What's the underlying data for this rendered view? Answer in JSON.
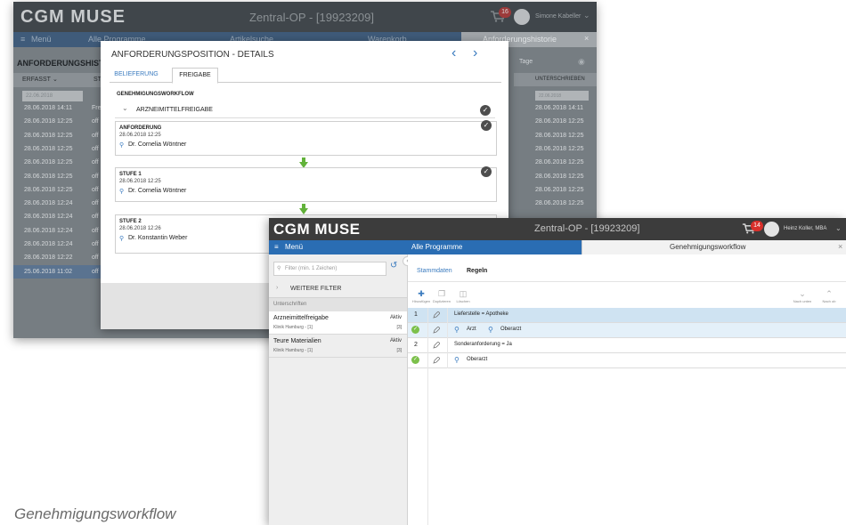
{
  "back_window": {
    "logo": "CGM MUSE",
    "title": "Zentral-OP - [19923209]",
    "badge": "16",
    "user": "Simone Kabeller",
    "nav": {
      "menu": "Menü",
      "programs": "Alle Programme",
      "articles": "Artikelsuche",
      "cart": "Warenkorb",
      "history_tab": "Anforderungshistorie"
    },
    "list_header": "ANFORDERUNGSHISTO",
    "col_erfasst": "ERFASST",
    "col_st": "ST",
    "date_filter": "22.06.2018",
    "rows": [
      {
        "date": "28.06.2018 14:11",
        "status": "Fre"
      },
      {
        "date": "28.06.2018 12:25",
        "status": "off"
      },
      {
        "date": "28.06.2018 12:25",
        "status": "off"
      },
      {
        "date": "28.06.2018 12:25",
        "status": "off"
      },
      {
        "date": "28.06.2018 12:25",
        "status": "off"
      },
      {
        "date": "28.06.2018 12:25",
        "status": "off"
      },
      {
        "date": "28.06.2018 12:25",
        "status": "off"
      },
      {
        "date": "28.06.2018 12:24",
        "status": "off"
      },
      {
        "date": "28.06.2018 12:24",
        "status": "off"
      },
      {
        "date": "28.06.2018 12:24",
        "status": "off"
      },
      {
        "date": "28.06.2018 12:24",
        "status": "off"
      },
      {
        "date": "28.06.2018 12:22",
        "status": "off"
      },
      {
        "date": "25.06.2018 11:02",
        "status": "off"
      }
    ],
    "right_panel": {
      "days": "Tage",
      "col": "UNTERSCHRIEBEN",
      "date_filter": "22.06.2018",
      "dates": [
        "28.06.2018 14:11",
        "28.06.2018 12:25",
        "28.06.2018 12:25",
        "28.06.2018 12:25",
        "28.06.2018 12:25",
        "28.06.2018 12:25",
        "28.06.2018 12:25",
        "28.06.2018 12:25"
      ]
    }
  },
  "modal": {
    "title": "ANFORDERUNGSPOSITION - DETAILS",
    "tab_belieferung": "BELIEFERUNG",
    "tab_freigabe": "FREIGABE",
    "section": "GENEHMIGUNGSWORKFLOW",
    "group": "ARZNEIMITTELFREIGABE",
    "steps": [
      {
        "label": "ANFORDERUNG",
        "date": "28.06.2018 12:25",
        "person": "Dr. Cornelia Wöntner"
      },
      {
        "label": "STUFE 1",
        "date": "28.06.2018 12:25",
        "person": "Dr. Cornelia Wöntner"
      },
      {
        "label": "STUFE 2",
        "date": "28.06.2018 12:26",
        "person": "Dr. Konstantin Weber"
      }
    ]
  },
  "front_window": {
    "logo": "CGM MUSE",
    "title": "Zentral-OP - [19923209]",
    "badge": "14",
    "user": "Heinz Koller, MBA",
    "nav": {
      "menu": "Menü",
      "programs": "Alle Programme",
      "tab": "Genehmigungsworkflow",
      "close": "×"
    },
    "search_placeholder": "Filter (min. 1 Zeichen)",
    "more_filters": "WEITERE FILTER",
    "section": "Unterschriften",
    "workflows": [
      {
        "name": "Arzneimittelfreigabe",
        "status": "Aktiv",
        "clinic": "Klinik Hamburg - [1]",
        "count": "[3]"
      },
      {
        "name": "Teure Materialien",
        "status": "Aktiv",
        "clinic": "Klinik Hamburg - [1]",
        "count": "[3]"
      }
    ],
    "tabs": {
      "stammdaten": "Stammdaten",
      "regeln": "Regeln"
    },
    "toolbar": {
      "add": "Hinzufügen",
      "duplicate": "Duplizieren",
      "delete": "Löschen",
      "down": "Nach unten",
      "up": "Nach ob"
    },
    "rules": [
      {
        "num": "1",
        "text": "Lieferstelle = Apotheke"
      },
      {
        "num": "2",
        "text": "Sonderanforderung = Ja"
      }
    ],
    "approvers": [
      {
        "roles": [
          "Arzt",
          "Oberarzt"
        ]
      },
      {
        "roles": [
          "Oberarzt"
        ]
      }
    ]
  },
  "caption": "Genehmigungsworkflow"
}
